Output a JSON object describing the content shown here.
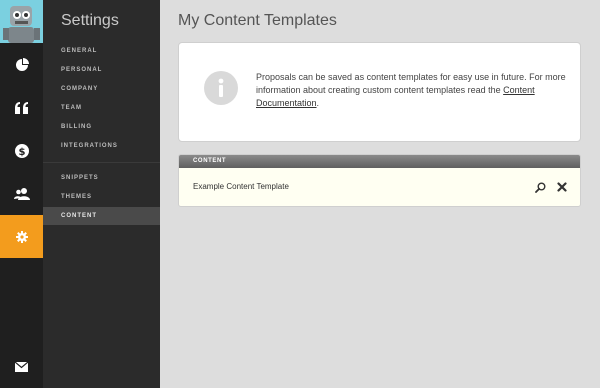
{
  "subnav": {
    "title": "Settings",
    "items": [
      {
        "label": "GENERAL",
        "active": false
      },
      {
        "label": "PERSONAL",
        "active": false
      },
      {
        "label": "COMPANY",
        "active": false
      },
      {
        "label": "TEAM",
        "active": false
      },
      {
        "label": "BILLING",
        "active": false
      },
      {
        "label": "INTEGRATIONS",
        "active": false
      },
      {
        "label": "SNIPPETS",
        "active": false
      },
      {
        "label": "THEMES",
        "active": false
      },
      {
        "label": "CONTENT",
        "active": true
      }
    ]
  },
  "rail": {
    "items": [
      {
        "icon": "pie-chart-icon",
        "active": false
      },
      {
        "icon": "quote-icon",
        "active": false
      },
      {
        "icon": "dollar-icon",
        "active": false
      },
      {
        "icon": "users-icon",
        "active": false
      },
      {
        "icon": "gear-icon",
        "active": true
      },
      {
        "icon": "envelope-icon",
        "active": false
      }
    ],
    "accent_color": "#f39c1d"
  },
  "main": {
    "title": "My Content Templates",
    "info": {
      "text": "Proposals can be saved as content templates for easy use in future. For more information about creating custom content templates read the ",
      "link": "Content Documentation",
      "suffix": "."
    },
    "panel": {
      "header": "CONTENT",
      "rows": [
        {
          "label": "Example Content Template"
        }
      ]
    }
  }
}
